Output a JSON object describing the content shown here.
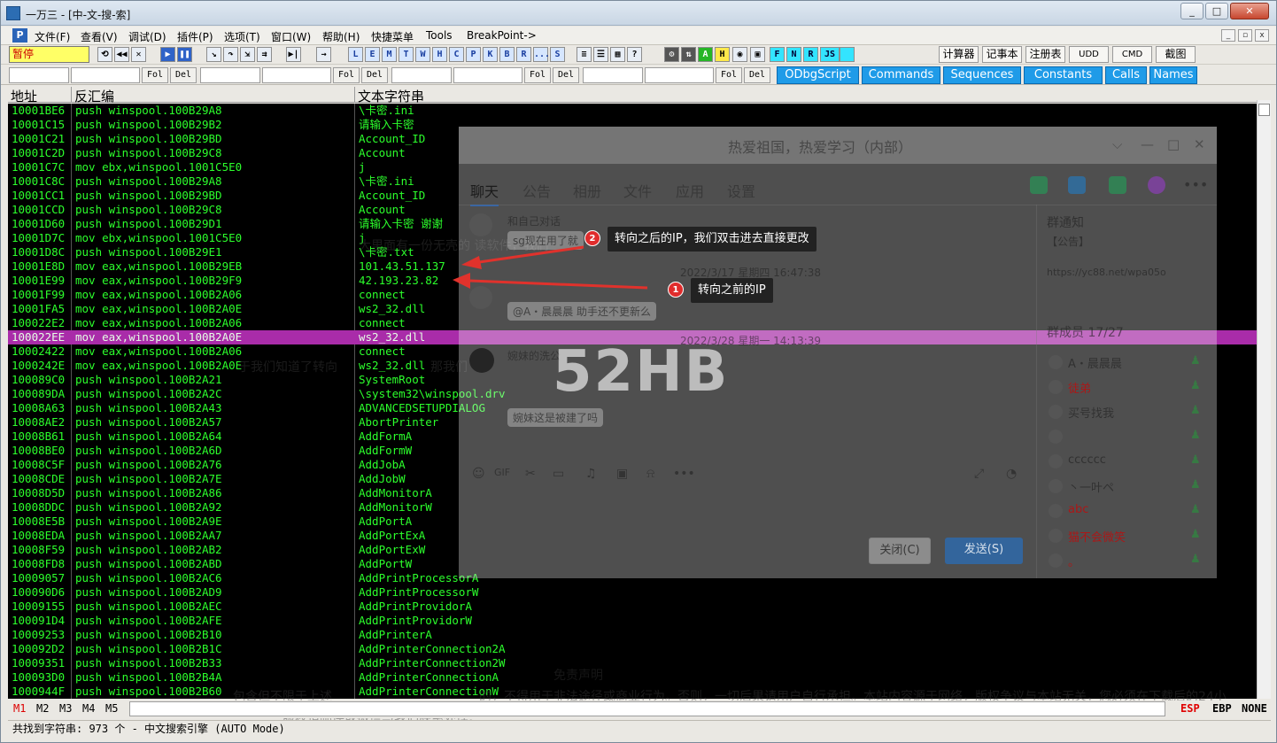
{
  "window": {
    "title": "一万三 - [中-文-搜-索]",
    "controls": [
      "_",
      "□",
      "✕"
    ]
  },
  "menu": {
    "icon_letter": "P",
    "items": [
      "文件(F)",
      "查看(V)",
      "调试(D)",
      "插件(P)",
      "选项(T)",
      "窗口(W)",
      "帮助(H)",
      "快捷菜单",
      "Tools",
      "BreakPoint->"
    ]
  },
  "toolbar": {
    "status": "暂停",
    "letters": [
      "L",
      "E",
      "M",
      "T",
      "W",
      "H",
      "C",
      "P",
      "K",
      "B",
      "R",
      "...",
      "S"
    ],
    "plugin_letters": [
      "F",
      "N",
      "R",
      "JS"
    ],
    "right_buttons": [
      "计算器",
      "记事本",
      "注册表",
      "UDD",
      "CMD",
      "截图"
    ]
  },
  "fieldbar": {
    "fol_label": "Fol",
    "del_label": "Del",
    "tabs": [
      "ODbgScript",
      "Commands",
      "Sequences",
      "Constants",
      "Calls",
      "Names"
    ]
  },
  "columns": {
    "address": "地址",
    "disasm": "反汇编",
    "text": "文本字符串"
  },
  "rows": [
    {
      "addr": "10001BE6",
      "asm": "push winspool.100B29A8",
      "text": "\\卡密.ini"
    },
    {
      "addr": "10001C15",
      "asm": "push winspool.100B29B2",
      "text": "请输入卡密"
    },
    {
      "addr": "10001C21",
      "asm": "push winspool.100B29BD",
      "text": "Account_ID"
    },
    {
      "addr": "10001C2D",
      "asm": "push winspool.100B29C8",
      "text": "Account"
    },
    {
      "addr": "10001C7C",
      "asm": "mov ebx,winspool.1001C5E0",
      "text": "j"
    },
    {
      "addr": "10001C8C",
      "asm": "push winspool.100B29A8",
      "text": "\\卡密.ini"
    },
    {
      "addr": "10001CC1",
      "asm": "push winspool.100B29BD",
      "text": "Account_ID"
    },
    {
      "addr": "10001CCD",
      "asm": "push winspool.100B29C8",
      "text": "Account"
    },
    {
      "addr": "10001D60",
      "asm": "push winspool.100B29D1",
      "text": "请输入卡密 谢谢"
    },
    {
      "addr": "10001D7C",
      "asm": "mov ebx,winspool.1001C5E0",
      "text": "j"
    },
    {
      "addr": "10001D8C",
      "asm": "push winspool.100B29E1",
      "text": "\\卡密.txt"
    },
    {
      "addr": "10001E8D",
      "asm": "mov eax,winspool.100B29EB",
      "text": "101.43.51.137"
    },
    {
      "addr": "10001E99",
      "asm": "mov eax,winspool.100B29F9",
      "text": "42.193.23.82"
    },
    {
      "addr": "10001F99",
      "asm": "mov eax,winspool.100B2A06",
      "text": "connect"
    },
    {
      "addr": "10001FA5",
      "asm": "mov eax,winspool.100B2A0E",
      "text": "ws2_32.dll"
    },
    {
      "addr": "100022E2",
      "asm": "mov eax,winspool.100B2A06",
      "text": "connect"
    },
    {
      "addr": "100022EE",
      "asm": "mov eax,winspool.100B2A0E",
      "text": "ws2_32.dll",
      "selected": true
    },
    {
      "addr": "10002422",
      "asm": "mov eax,winspool.100B2A06",
      "text": "connect"
    },
    {
      "addr": "1000242E",
      "asm": "mov eax,winspool.100B2A0E",
      "text": "ws2_32.dll"
    },
    {
      "addr": "100089C0",
      "asm": "push winspool.100B2A21",
      "text": "SystemRoot"
    },
    {
      "addr": "100089DA",
      "asm": "push winspool.100B2A2C",
      "text": "\\system32\\winspool.drv"
    },
    {
      "addr": "10008A63",
      "asm": "push winspool.100B2A43",
      "text": "ADVANCEDSETUPDIALOG"
    },
    {
      "addr": "10008AE2",
      "asm": "push winspool.100B2A57",
      "text": "AbortPrinter"
    },
    {
      "addr": "10008B61",
      "asm": "push winspool.100B2A64",
      "text": "AddFormA"
    },
    {
      "addr": "10008BE0",
      "asm": "push winspool.100B2A6D",
      "text": "AddFormW"
    },
    {
      "addr": "10008C5F",
      "asm": "push winspool.100B2A76",
      "text": "AddJobA"
    },
    {
      "addr": "10008CDE",
      "asm": "push winspool.100B2A7E",
      "text": "AddJobW"
    },
    {
      "addr": "10008D5D",
      "asm": "push winspool.100B2A86",
      "text": "AddMonitorA"
    },
    {
      "addr": "10008DDC",
      "asm": "push winspool.100B2A92",
      "text": "AddMonitorW"
    },
    {
      "addr": "10008E5B",
      "asm": "push winspool.100B2A9E",
      "text": "AddPortA"
    },
    {
      "addr": "10008EDA",
      "asm": "push winspool.100B2AA7",
      "text": "AddPortExA"
    },
    {
      "addr": "10008F59",
      "asm": "push winspool.100B2AB2",
      "text": "AddPortExW"
    },
    {
      "addr": "10008FD8",
      "asm": "push winspool.100B2ABD",
      "text": "AddPortW"
    },
    {
      "addr": "10009057",
      "asm": "push winspool.100B2AC6",
      "text": "AddPrintProcessorA"
    },
    {
      "addr": "100090D6",
      "asm": "push winspool.100B2AD9",
      "text": "AddPrintProcessorW"
    },
    {
      "addr": "10009155",
      "asm": "push winspool.100B2AEC",
      "text": "AddPrintProvidorA"
    },
    {
      "addr": "100091D4",
      "asm": "push winspool.100B2AFE",
      "text": "AddPrintProvidorW"
    },
    {
      "addr": "10009253",
      "asm": "push winspool.100B2B10",
      "text": "AddPrinterA"
    },
    {
      "addr": "100092D2",
      "asm": "push winspool.100B2B1C",
      "text": "AddPrinterConnection2A"
    },
    {
      "addr": "10009351",
      "asm": "push winspool.100B2B33",
      "text": "AddPrinterConnection2W"
    },
    {
      "addr": "100093D0",
      "asm": "push winspool.100B2B4A",
      "text": "AddPrinterConnectionA"
    },
    {
      "addr": "1000944F",
      "asm": "push winspool.100B2B60",
      "text": "AddPrinterConnectionW"
    }
  ],
  "cmdbar": {
    "tabs": [
      "M1",
      "M2",
      "M3",
      "M4",
      "M5"
    ],
    "regs": [
      "ESP",
      "EBP",
      "NONE"
    ]
  },
  "statusbar": {
    "text": "共找到字符串: 973 个  -  中文搜索引擎 (AUTO Mode)"
  },
  "chat_overlay": {
    "title": "热爱祖国，热爱学习（内部）",
    "tabs": [
      "聊天",
      "公告",
      "相册",
      "文件",
      "应用",
      "设置"
    ],
    "msg1_name": "和自己对话",
    "msg1_bubble": "sg现在用了就",
    "date1": "2022/3/17 星期四 16:47:38",
    "msg2_bubble": "@A・晨晨晨 助手还不更新么",
    "date2": "2022/3/28 星期一 14:13:39",
    "msg3_name": "婉妹的洗公",
    "msg3_bubble": "婉妹这是被建了吗",
    "notice_title": "群通知",
    "notice_text": "【公告】",
    "notice_url": "https://yc88.net/wpa05o",
    "members_title": "群成员 17/27",
    "members": [
      {
        "name": "A・晨晨晨",
        "red": false
      },
      {
        "name": "徒弟",
        "red": true
      },
      {
        "name": "买号找我",
        "red": false
      },
      {
        "name": "",
        "red": false
      },
      {
        "name": "cccccc",
        "red": false
      },
      {
        "name": "丶一叶ペ",
        "red": false
      },
      {
        "name": "abc",
        "red": true
      },
      {
        "name": "猫不会微笑",
        "red": true
      },
      {
        "name": "。",
        "red": true
      }
    ],
    "close_button": "关闭(C)",
    "send_button": "发送(S)"
  },
  "watermark": "52HB",
  "annotations": {
    "a1_num": "1",
    "a1_text": "转向之前的IP",
    "a2_num": "2",
    "a2_text": "转向之后的IP，我们双击进去直接更改"
  },
  "background_text": {
    "bg1": "大里面有一份无壳的 读软件，我们",
    "bg2": "于我们知道了转向",
    "bg3": "那我们",
    "bg4": "免责声明",
    "bg5": "包含但不限于上述",
    "bg6": "的，不得用于非法途径或商业行为。否则，一切后果请用户自行承担。本站内容源于网络，版权争议与本站无关，您必须在下载后的24小",
    "bg7": "版权请邮件或微信与我们联系处理。"
  },
  "colors": {
    "list_bg": "#000000",
    "list_text": "#2cff2c",
    "selected_row": "#a92ca9",
    "status_yellow": "#ffff66",
    "annotation_red": "#e02c2c",
    "arrow_red": "#e0322c"
  }
}
